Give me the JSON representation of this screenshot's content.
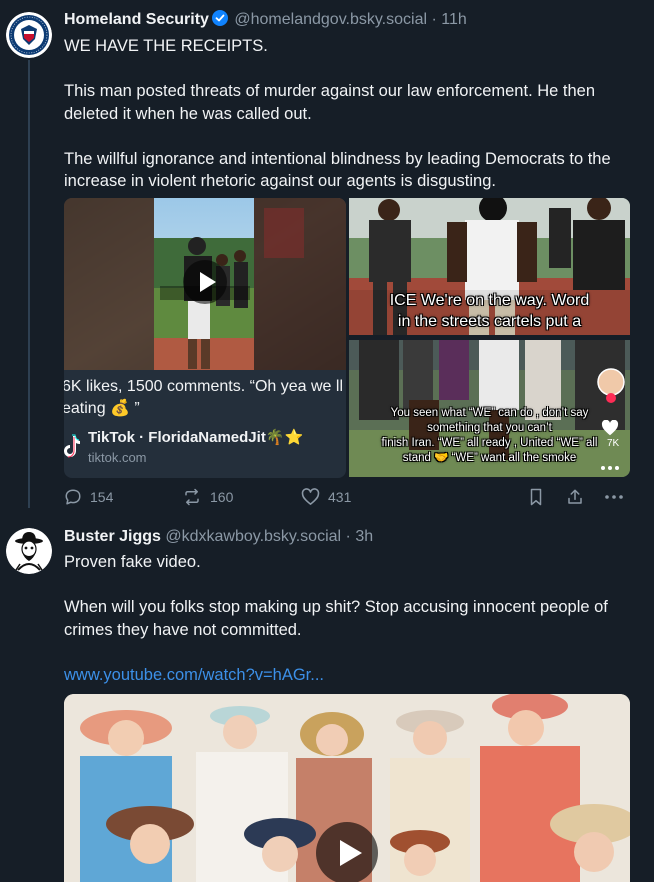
{
  "post1": {
    "author_name": "Homeland Security",
    "handle": "@homelandgov.bsky.social",
    "separator": "·",
    "time": "11h",
    "text": {
      "line1": "WE HAVE THE RECEIPTS.",
      "para2": "This man posted threats of murder against our law enforcement. He then deleted it when he was called out.",
      "para3": "The willful ignorance and intentional blindness by leading Democrats to the increase in violent rhetoric against our agents is disgusting."
    },
    "embed": {
      "caption": "6K likes, 1500 comments. “Oh yea we ll eating 💰 ”",
      "title": "TikTok · FloridaNamedJit🌴⭐",
      "domain": "tiktok.com"
    },
    "images": {
      "img1_caption_l1": "ICE We're on the way. Word",
      "img1_caption_l2": "in the streets cartels put a",
      "img2_l1": "You seen what “WE” can do , don’t say",
      "img2_l2": "something that you can’t",
      "img2_l3": "finish Iran. “WE” all ready , United “WE” all",
      "img2_l4": "stand 🤝 “WE” want all the smoke",
      "img2_count": "7K"
    },
    "stats": {
      "replies": "154",
      "reposts": "160",
      "likes": "431"
    },
    "colors": {
      "verified": "#1083fe",
      "link": "#3c90e8"
    }
  },
  "post2": {
    "author_name": "Buster Jiggs",
    "handle": "@kdxkawboy.bsky.social",
    "separator": "·",
    "time": "3h",
    "text": {
      "line1": "Proven fake video.",
      "para2": "When will you folks stop making up shit? Stop accusing innocent people of crimes they have not committed.",
      "link": "www.youtube.com/watch?v=hAGr..."
    }
  },
  "icons": {
    "reply": "speech-bubble-icon",
    "repost": "repost-arrows-icon",
    "like": "heart-icon",
    "bookmark": "bookmark-icon",
    "share": "share-icon",
    "more": "ellipsis-icon",
    "play": "play-icon",
    "verified": "verified-check-icon",
    "tiktok": "tiktok-logo-icon"
  }
}
